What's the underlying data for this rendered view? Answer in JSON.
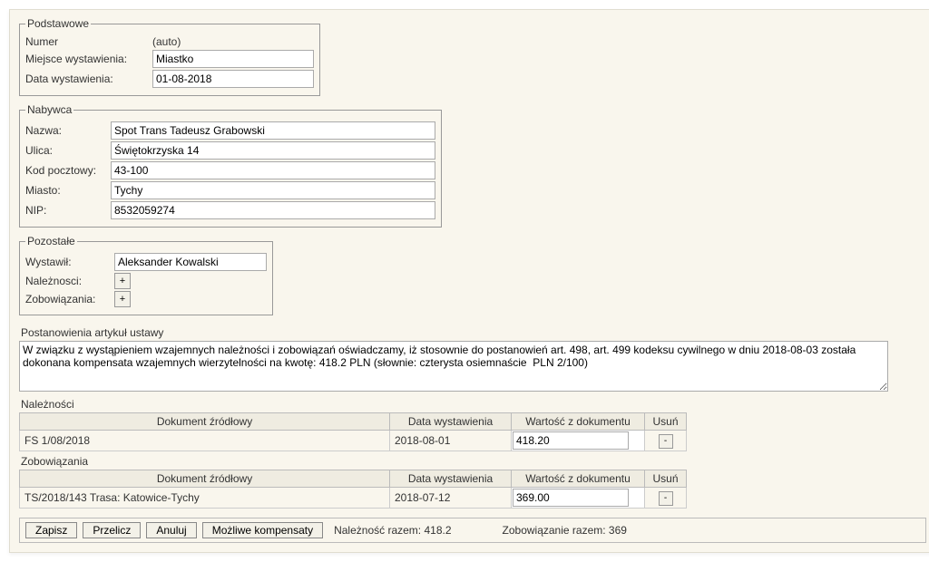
{
  "basic": {
    "legend": "Podstawowe",
    "numberLabel": "Numer",
    "numberValue": "(auto)",
    "placeLabel": "Miejsce wystawienia:",
    "placeValue": "Miastko",
    "dateLabel": "Data wystawienia:",
    "dateValue": "01-08-2018"
  },
  "buyer": {
    "legend": "Nabywca",
    "nameLabel": "Nazwa:",
    "nameValue": "Spot Trans Tadeusz Grabowski",
    "streetLabel": "Ulica:",
    "streetValue": "Świętokrzyska 14",
    "zipLabel": "Kod pocztowy:",
    "zipValue": "43-100",
    "cityLabel": "Miasto:",
    "cityValue": "Tychy",
    "nipLabel": "NIP:",
    "nipValue": "8532059274"
  },
  "other": {
    "legend": "Pozostałe",
    "issuerLabel": "Wystawił:",
    "issuerValue": "Aleksander Kowalski",
    "receivablesLabel": "Należnosci:",
    "liabilitiesLabel": "Zobowiązania:",
    "plus": "+"
  },
  "provisions": {
    "label": "Postanowienia artykuł ustawy",
    "text": "W związku z wystąpieniem wzajemnych należności i zobowiązań oświadczamy, iż stosownie do postanowień art. 498, art. 499 kodeksu cywilnego w dniu 2018-08-03 została dokonana kompensata wzajemnych wierzytelności na kwotę: 418.2 PLN (słownie: czterysta osiemnaście  PLN 2/100)"
  },
  "tablesHeaders": {
    "doc": "Dokument źródłowy",
    "date": "Data wystawienia",
    "value": "Wartość z dokumentu",
    "delete": "Usuń"
  },
  "receivables": {
    "title": "Należności",
    "rows": [
      {
        "doc": "FS 1/08/2018",
        "date": "2018-08-01",
        "value": "418.20"
      }
    ]
  },
  "liabilities": {
    "title": "Zobowiązania",
    "rows": [
      {
        "doc": "TS/2018/143  Trasa: Katowice-Tychy",
        "date": "2018-07-12",
        "value": "369.00"
      }
    ]
  },
  "footer": {
    "save": "Zapisz",
    "recalc": "Przelicz",
    "cancel": "Anuluj",
    "possible": "Możliwe kompensaty",
    "recTotalLabel": "Należność razem:",
    "recTotalValue": "418.2",
    "liabTotalLabel": "Zobowiązanie razem:",
    "liabTotalValue": "369"
  },
  "delBtn": "-"
}
